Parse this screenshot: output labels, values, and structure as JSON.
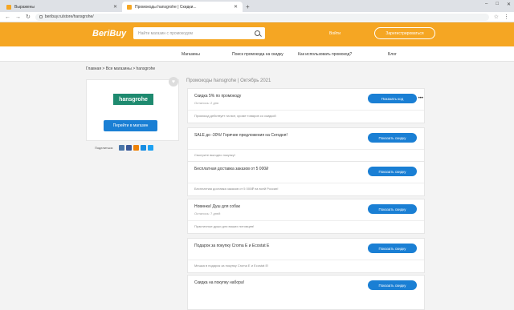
{
  "browser": {
    "tabs": [
      {
        "label": "Выражены",
        "active": false
      },
      {
        "label": "Промокоды hansgrohe | Скидки...",
        "active": true
      }
    ],
    "url": "beribuy.ru/store/hansgrohe/",
    "new_tab": "+",
    "controls": [
      "–",
      "□",
      "✕"
    ]
  },
  "header": {
    "logo": "BeriBuy",
    "search_placeholder": "Найти магазин с промокодом",
    "login": "Войти",
    "register": "Зарегистрироваться"
  },
  "subnav": [
    "Магазины",
    "Поиск промокода на скидку",
    "Как использовать промокод?",
    "Блог"
  ],
  "breadcrumb": "Главная > Все магазины > hansgrohe",
  "store": {
    "logo_text": "hansgrohe",
    "go_button": "Перейти в магазин",
    "share_label": "Поделиться:"
  },
  "page_title": "Промокоды hansgrohe | Октябрь 2021",
  "coupons": [
    {
      "title": "Скидка 5% по промокоду",
      "meta": "Осталось: 2 дня",
      "desc": "Промокод действует на все, кроме товаров со скидкой",
      "button": "Показать код"
    },
    {
      "title": "SALE до -30%! Горячие предложения на Сегодня!",
      "meta": "",
      "desc": "Смотрите выгодно покупку!",
      "button": "Показать скидку"
    },
    {
      "title": "Бесплатная доставка заказов от 5 000₽",
      "meta": "",
      "desc": "Бесплатная доставка заказов от 5 000₽ на всей России!",
      "button": "Показать скидку"
    },
    {
      "title": "Новинка! Душ для собак",
      "meta": "Осталось: 7 дней",
      "desc": "Практичные души для ваших питомцев!",
      "button": "Показать скидку"
    },
    {
      "title": "Подарок за покупку Croma E и Ecostat E",
      "meta": "",
      "desc": "Мешка в подарок за покупку Croma E и Ecostat E!",
      "button": "Показать скидку"
    },
    {
      "title": "Скидка на покупку набора!",
      "meta": "",
      "desc": "",
      "button": "Показать скидку"
    }
  ],
  "colors": {
    "brand": "#f5a623",
    "button": "#1a7fd4",
    "hansgrohe": "#1e8a6f"
  }
}
